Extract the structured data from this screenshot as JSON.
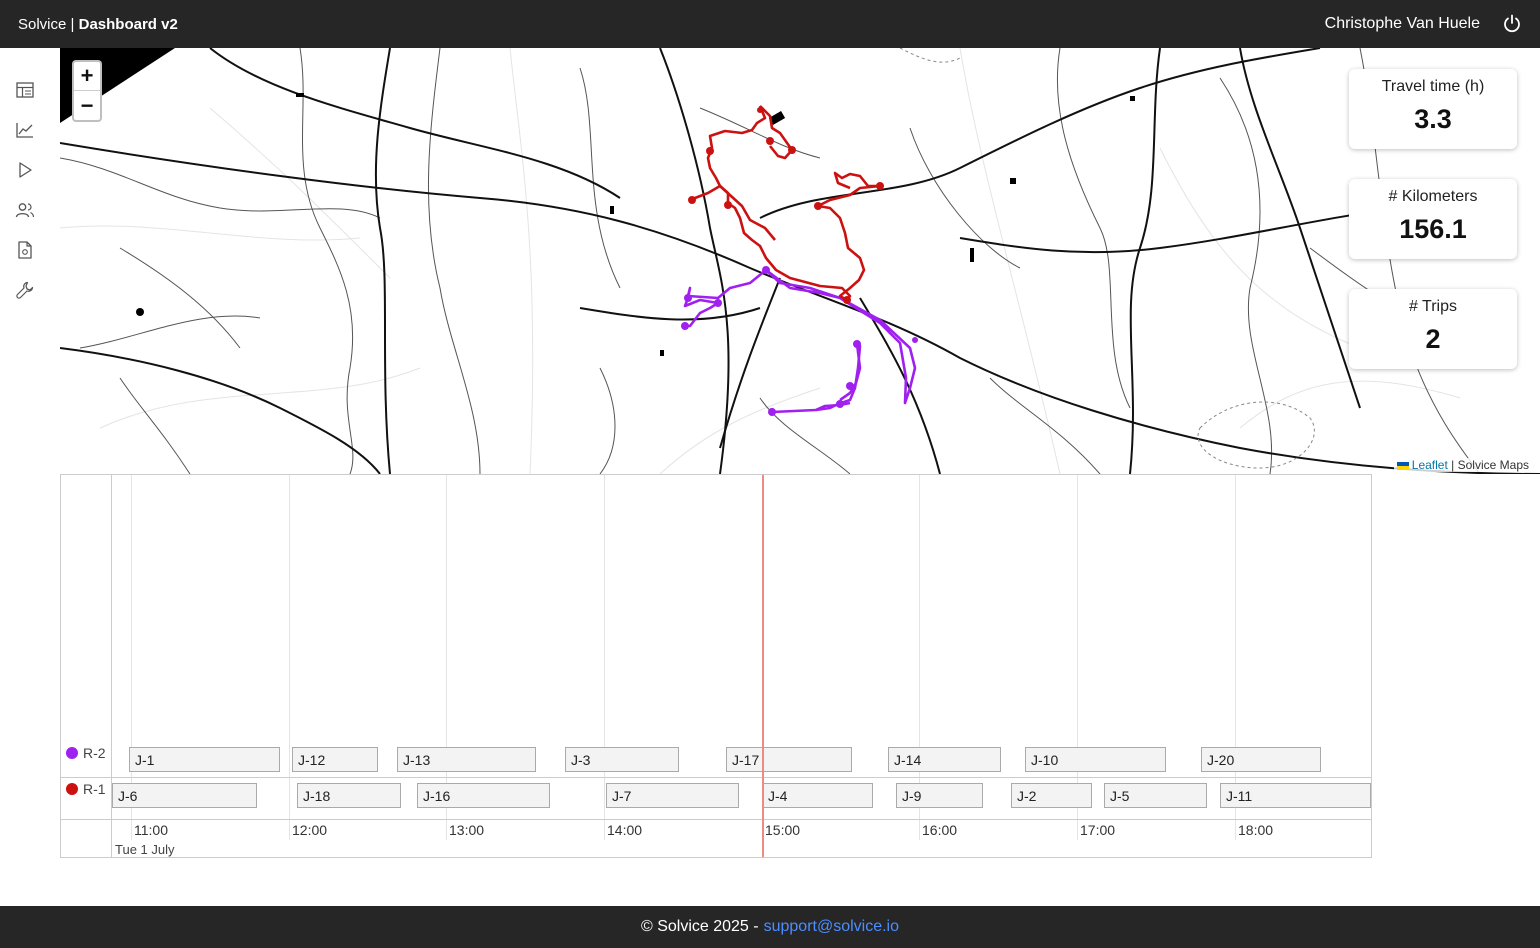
{
  "header": {
    "brand": "Solvice",
    "separator": "|",
    "page_title": "Dashboard v2",
    "user_name": "Christophe Van Huele",
    "logout_icon": "power-icon"
  },
  "sidebar": {
    "items": [
      {
        "icon": "table-icon",
        "name": "Data"
      },
      {
        "icon": "chart-line-icon",
        "name": "Analytics"
      },
      {
        "icon": "play-icon",
        "name": "Run"
      },
      {
        "icon": "users-icon",
        "name": "Users"
      },
      {
        "icon": "document-icon",
        "name": "Documents"
      },
      {
        "icon": "wrench-icon",
        "name": "Settings"
      }
    ]
  },
  "map": {
    "zoom_in": "+",
    "zoom_out": "−",
    "attribution_link": "Leaflet",
    "attribution_sep": "|",
    "attribution_text": "Solvice Maps",
    "route_colors": {
      "R-1": "#cc1111",
      "R-2": "#a020f0"
    }
  },
  "kpis": [
    {
      "label": "Travel time (h)",
      "value": "3.3"
    },
    {
      "label": "# Kilometers",
      "value": "156.1"
    },
    {
      "label": "# Trips",
      "value": "2"
    }
  ],
  "timeline": {
    "rows": [
      {
        "label": "R-2",
        "color": "#a020f0",
        "jobs": [
          "J-1",
          "J-12",
          "J-13",
          "J-3",
          "J-17",
          "J-14",
          "J-10",
          "J-20"
        ]
      },
      {
        "label": "R-1",
        "color": "#cc1111",
        "jobs": [
          "J-6",
          "J-18",
          "J-16",
          "J-7",
          "J-4",
          "J-9",
          "J-2",
          "J-5",
          "J-11"
        ]
      }
    ],
    "ticks": [
      "11:00",
      "12:00",
      "13:00",
      "14:00",
      "15:00",
      "16:00",
      "17:00",
      "18:00"
    ],
    "date": "Tue 1 July",
    "now_line_color": "#ee8a80"
  },
  "footer": {
    "copyright": "© Solvice 2025 -",
    "email": "support@solvice.io"
  }
}
